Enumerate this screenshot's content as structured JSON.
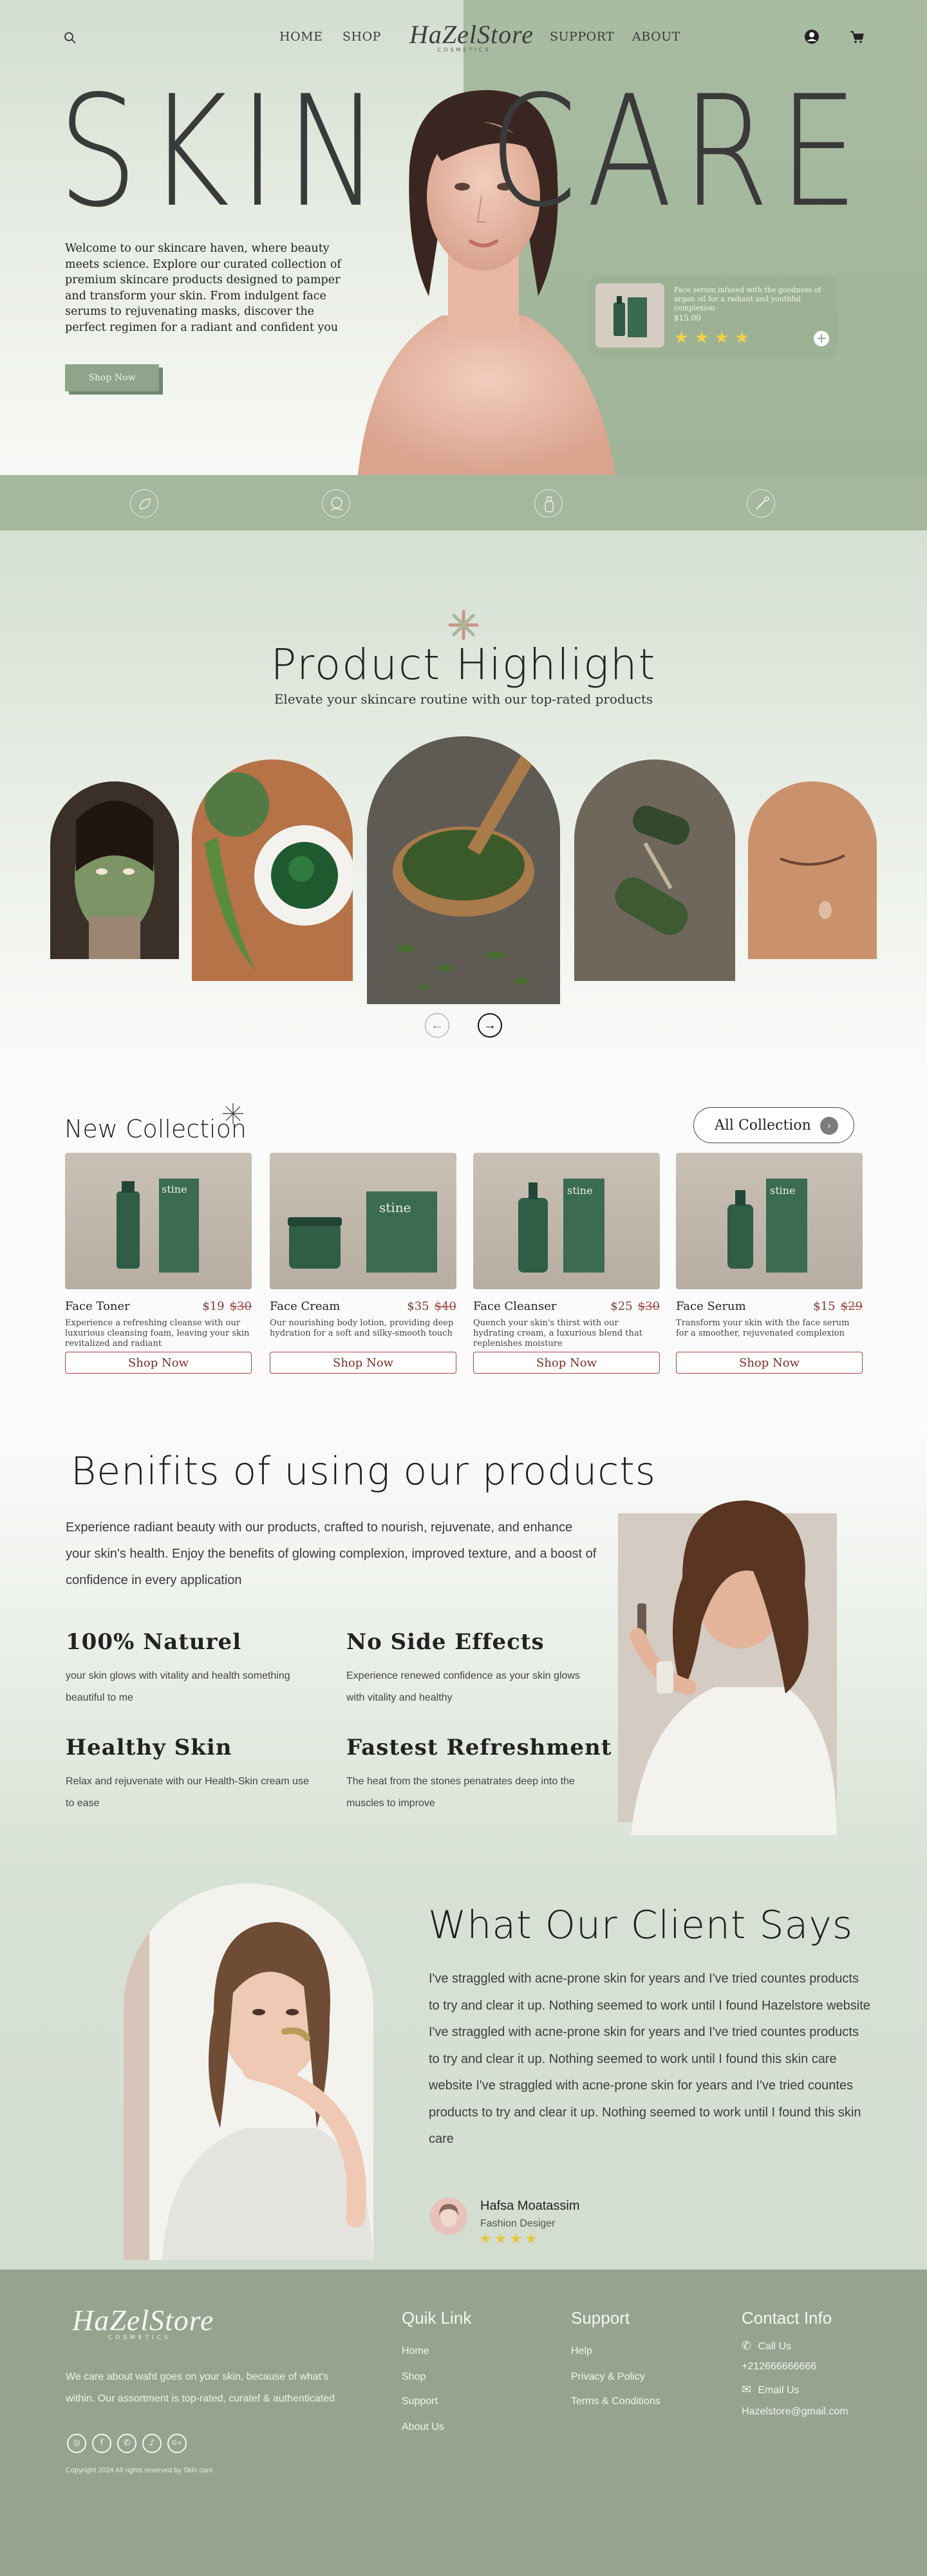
{
  "nav": {
    "links_left": [
      "HOME",
      "SHOP"
    ],
    "links_right": [
      "SUPPORT",
      "ABOUT"
    ],
    "logo": "HaZelStore",
    "logo_sub": "COSMETICS",
    "icons": [
      "search-icon",
      "user-icon",
      "cart-icon"
    ]
  },
  "hero": {
    "title_left": "SKIN",
    "title_right": "CARE",
    "copy": "Welcome to our skincare haven, where beauty meets science. Explore our curated collection of premium skincare products designed to pamper and transform your skin. From indulgent face serums to rejuvenating masks, discover the perfect regimen for a radiant and confident you",
    "cta": "Shop Now",
    "promo": {
      "text": "Face serum infused with the goodness of argan oil for a radiant and youthful complexion",
      "price": "$15.00",
      "stars": "★★★★"
    },
    "feature_icons": [
      "leaf-badge-icon",
      "face-badge-icon",
      "bottle-badge-icon",
      "dropper-badge-icon"
    ]
  },
  "highlight": {
    "title": "Product Highlight",
    "subtitle": "Elevate your skincare routine with our top-rated products",
    "images": [
      "green-mask-woman",
      "matcha-aloe-bowl",
      "herbs-spoon",
      "jade-roller",
      "skin-closeup"
    ],
    "prev": "←",
    "next": "→"
  },
  "collection": {
    "title": "New Collection",
    "all_button": "All Collection",
    "all_button_arrow": "›",
    "brand": "stine",
    "products": [
      {
        "name": "Face Toner",
        "price": "$19",
        "old_price": "$30",
        "desc": "Experience a refreshing cleanse with our luxurious cleansing foam, leaving your skin revitalized and radiant",
        "cta": "Shop Now"
      },
      {
        "name": "Face Cream",
        "price": "$35",
        "old_price": "$40",
        "desc": "Our nourishing body lotion, providing deep hydration for a soft and silky-smooth touch",
        "cta": "Shop Now"
      },
      {
        "name": "Face Cleanser",
        "price": "$25",
        "old_price": "$30",
        "desc": "Quench your skin's thirst with our hydrating cream, a luxurious blend that replenishes moisture",
        "cta": "Shop Now"
      },
      {
        "name": "Face Serum",
        "price": "$15",
        "old_price": "$29",
        "desc": "Transform your skin with  the face serum for a smoother, rejuvenated complexion",
        "cta": "Shop Now"
      }
    ]
  },
  "benefits": {
    "title": "Benifits of using our products",
    "intro": "Experience radiant beauty with our products, crafted to nourish, rejuvenate, and enhance your skin's health. Enjoy the benefits of glowing complexion, improved texture, and a boost of confidence in every application",
    "items": [
      {
        "title": "100% Naturel",
        "text": "your skin glows with vitality and health something beautiful to me"
      },
      {
        "title": "No Side Effects",
        "text": "Experience renewed confidence as your skin glows with vitality and healthy"
      },
      {
        "title": "Healthy Skin",
        "text": "Relax and rejuvenate with our Health-Skin cream use to ease"
      },
      {
        "title": "Fastest Refreshment",
        "text": "The heat from the stones penatrates deep into the muscles to improve"
      }
    ]
  },
  "testimonial": {
    "title": "What Our Client Says",
    "body": "I've straggled with acne-prone skin for years and I've tried countes products to try and clear it up. Nothing seemed to work until I found Hazelstore website I've straggled with acne-prone skin for years and I've tried countes products to try and clear it up. Nothing seemed to work until I found this skin care website I've straggled with acne-prone skin for years and I've tried countes products to try and clear it up. Nothing seemed to work until I found this skin care",
    "name": "Hafsa Moatassim",
    "role": "Fashion Desiger",
    "stars": "★★★★"
  },
  "footer": {
    "logo": "HaZelStore",
    "logo_sub": "COSMETICS",
    "about": "We care about waht goes on your skin, because of what's within. Our assortment is top-rated, curatef & authenticated",
    "social": [
      "instagram-icon",
      "facebook-icon",
      "whatsapp-icon",
      "tiktok-icon",
      "google-plus-icon"
    ],
    "social_glyphs": [
      "◎",
      "f",
      "✆",
      "♪",
      "G+"
    ],
    "copyright": "Copyright 2024 All rights reserved by Skin care",
    "quick_title": "Quik Link",
    "quick_links": [
      "Home",
      "Shop",
      "Support",
      "About Us"
    ],
    "support_title": "Support",
    "support_links": [
      "Help",
      "Privacy & Policy",
      "Terms & Conditions"
    ],
    "contact_title": "Contact Info",
    "contact": {
      "call": "Call Us",
      "phone": "+212666666666",
      "email_label": "Email Us",
      "email": "Hazelstore@gmail.com"
    }
  }
}
